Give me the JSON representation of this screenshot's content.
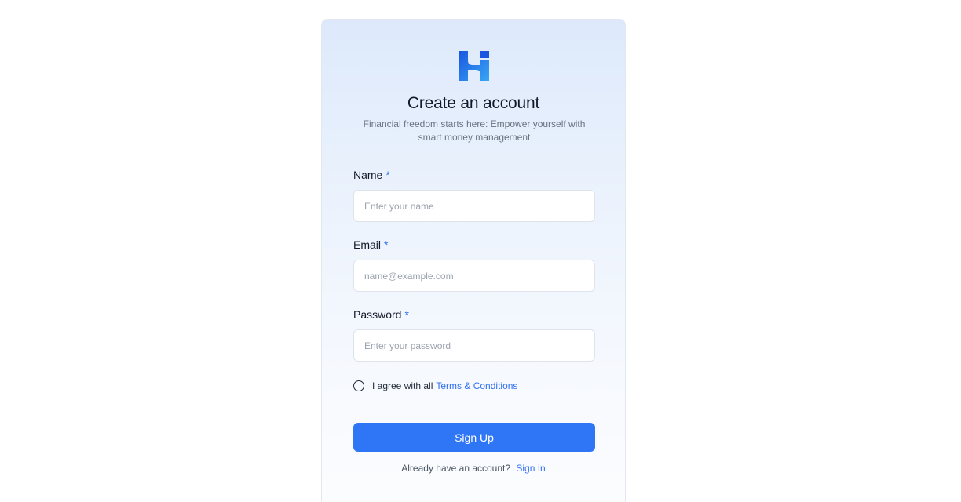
{
  "header": {
    "title": "Create an account",
    "subtitle": "Financial freedom starts here: Empower yourself with smart money management"
  },
  "form": {
    "name": {
      "label": "Name",
      "required_mark": "*",
      "placeholder": "Enter your name",
      "value": ""
    },
    "email": {
      "label": "Email",
      "required_mark": "*",
      "placeholder": "name@example.com",
      "value": ""
    },
    "password": {
      "label": "Password",
      "required_mark": "*",
      "placeholder": "Enter your password",
      "value": ""
    },
    "agree": {
      "text": "I agree with all",
      "link": "Terms & Conditions",
      "checked": false
    },
    "submit_label": "Sign Up"
  },
  "footer": {
    "text": "Already have an account?",
    "link": "Sign In"
  },
  "icons": {
    "logo": "brand-logo-icon",
    "checkbox": "radio-circle-icon"
  },
  "colors": {
    "accent": "#2f76f6",
    "link": "#2f6ff2",
    "logo_dark": "#1a56e0",
    "logo_light": "#37a6f5"
  }
}
